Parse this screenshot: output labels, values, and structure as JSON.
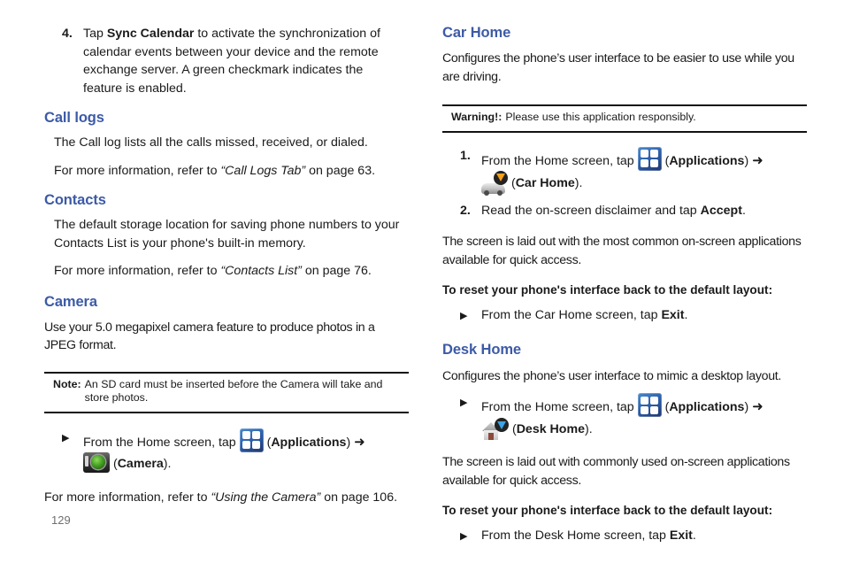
{
  "page": {
    "number": "129"
  },
  "left_column": {
    "step4": {
      "number": "4.",
      "text_before": "Tap ",
      "bold_term": "Sync Calendar",
      "text_after": " to activate the synchronization of calendar events between your device and the remote exchange server. A green checkmark indicates the feature is enabled."
    },
    "call_logs": {
      "heading": "Call logs",
      "body": "The Call log lists all the calls missed, received, or dialed.",
      "ref_prefix": "For more information, refer to ",
      "ref_title": "“Call Logs Tab”",
      "ref_suffix": " on page 63."
    },
    "contacts": {
      "heading": "Contacts",
      "body": "The default storage location for saving phone numbers to your Contacts List is your phone's built-in memory.",
      "ref_prefix": "For more information, refer to ",
      "ref_title": "“Contacts List”",
      "ref_suffix": " on page 76."
    },
    "camera": {
      "heading": "Camera",
      "body": "Use your 5.0 megapixel camera feature to produce photos in a JPEG format.",
      "note": {
        "label": "Note:",
        "text": "An SD card must be inserted before the Camera will take and store photos."
      },
      "step": {
        "bullet": "▶",
        "text_before": "From the Home screen, tap ",
        "apps_icon": "applications-icon",
        "apps_label": "Applications",
        "arrow": "➜",
        "camera_icon": "camera-icon",
        "camera_label": "Camera",
        "open_paren": "(",
        "close_paren": ")",
        "period": "."
      },
      "ref_prefix": "For more information, refer to ",
      "ref_title": "“Using the Camera”",
      "ref_suffix": " on page 106."
    }
  },
  "right_column": {
    "car_home": {
      "heading": "Car Home",
      "body": "Configures the phone’s user interface to be easier to use while you are driving.",
      "warning": {
        "label": "Warning!:",
        "text": "Please use this application responsibly."
      },
      "step1": {
        "number": "1.",
        "text_before": "From the Home screen, tap ",
        "apps_icon": "applications-icon",
        "apps_label": "Applications",
        "arrow": "➜",
        "target_icon": "car-home-icon",
        "target_label": "Car Home"
      },
      "step2": {
        "number": "2.",
        "text_before": "Read the on-screen disclaimer and tap ",
        "bold_term": "Accept",
        "text_after": "."
      },
      "layout_text": "The screen is laid out with the most common on-screen applications available for quick access.",
      "reset_heading": "To reset your phone's interface back to the default layout:",
      "reset_step": {
        "bullet": "▶",
        "text_before": "From the Car Home screen, tap ",
        "bold_term": "Exit",
        "text_after": "."
      }
    },
    "desk_home": {
      "heading": "Desk Home",
      "body": "Configures the phone’s user interface to mimic a desktop layout.",
      "step": {
        "bullet": "▶",
        "text_before": "From the Home screen, tap ",
        "apps_icon": "applications-icon",
        "apps_label": "Applications",
        "arrow": "➜",
        "target_icon": "desk-home-icon",
        "target_label": "Desk Home"
      },
      "layout_text": "The screen is laid out with commonly used on-screen applications available for quick access.",
      "reset_heading": "To reset your phone's interface back to the default layout:",
      "reset_step": {
        "bullet": "▶",
        "text_before": "From the Desk Home screen, tap ",
        "bold_term": "Exit",
        "text_after": "."
      }
    }
  },
  "colors": {
    "heading_blue": "#3c5aa6",
    "rule_black": "#111111",
    "page_number_gray": "#6f6f6f"
  }
}
